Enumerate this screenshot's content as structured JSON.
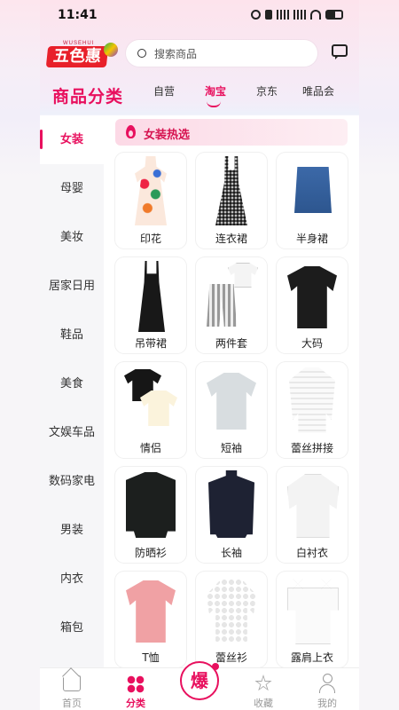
{
  "status_bar": {
    "time": "11:41"
  },
  "header": {
    "logo_small": "WUSEHUI",
    "logo_text": "五色惠",
    "search_placeholder": "搜索商品",
    "page_title": "商品分类",
    "tabs": [
      {
        "label": "自营",
        "active": false
      },
      {
        "label": "淘宝",
        "active": true
      },
      {
        "label": "京东",
        "active": false
      },
      {
        "label": "唯品会",
        "active": false
      }
    ]
  },
  "sidebar": {
    "items": [
      {
        "label": "女装",
        "active": true
      },
      {
        "label": "母婴"
      },
      {
        "label": "美妆"
      },
      {
        "label": "居家日用"
      },
      {
        "label": "鞋品"
      },
      {
        "label": "美食"
      },
      {
        "label": "文娱车品"
      },
      {
        "label": "数码家电"
      },
      {
        "label": "男装"
      },
      {
        "label": "内衣"
      },
      {
        "label": "箱包"
      }
    ]
  },
  "section": {
    "title": "女装热选"
  },
  "products": [
    {
      "label": "印花",
      "icon": "print-dress-icon"
    },
    {
      "label": "连衣裙",
      "icon": "plaid-dress-icon"
    },
    {
      "label": "半身裙",
      "icon": "denim-skirt-icon"
    },
    {
      "label": "吊带裙",
      "icon": "slip-dress-icon"
    },
    {
      "label": "两件套",
      "icon": "two-piece-icon"
    },
    {
      "label": "大码",
      "icon": "black-tee-icon"
    },
    {
      "label": "情侣",
      "icon": "couple-tee-icon"
    },
    {
      "label": "短袖",
      "icon": "gray-tee-icon"
    },
    {
      "label": "蕾丝拼接",
      "icon": "lace-blouse-icon"
    },
    {
      "label": "防晒衫",
      "icon": "cardigan-icon"
    },
    {
      "label": "长袖",
      "icon": "turtleneck-icon"
    },
    {
      "label": "白衬衣",
      "icon": "white-blouse-icon"
    },
    {
      "label": "T恤",
      "icon": "pink-tee-icon"
    },
    {
      "label": "蕾丝衫",
      "icon": "lace-shirt-icon"
    },
    {
      "label": "露肩上衣",
      "icon": "off-shoulder-icon"
    }
  ],
  "bottom_nav": {
    "items": [
      {
        "label": "首页",
        "icon": "home-icon"
      },
      {
        "label": "分类",
        "icon": "category-icon",
        "active": true
      },
      {
        "label": "爆",
        "icon": "hot-icon"
      },
      {
        "label": "收藏",
        "icon": "star-icon"
      },
      {
        "label": "我的",
        "icon": "user-icon"
      }
    ]
  },
  "colors": {
    "accent": "#e8105e",
    "sidebar_bg": "#f6f6f8"
  }
}
